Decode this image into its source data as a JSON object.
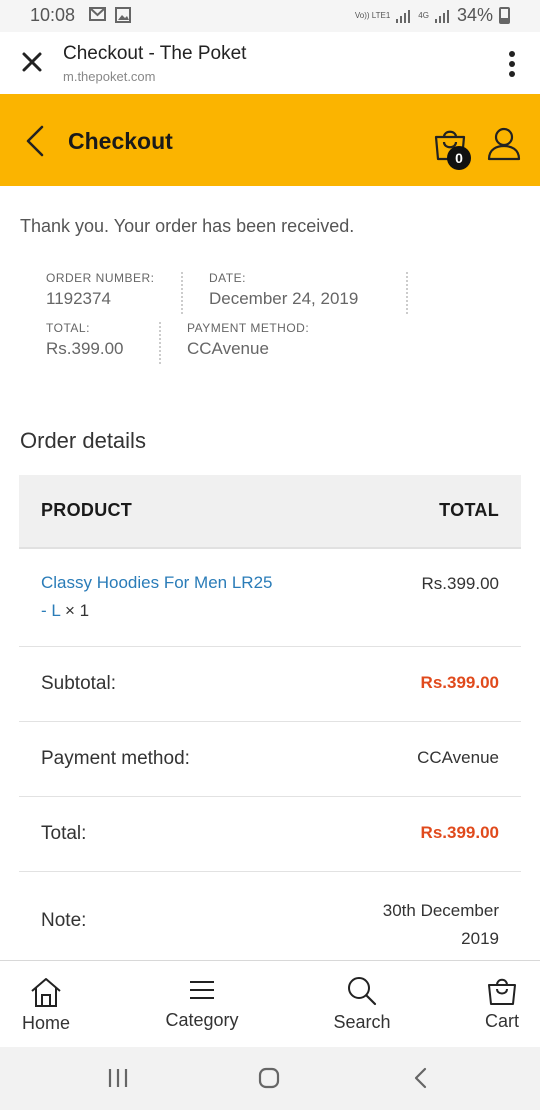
{
  "status_bar": {
    "time": "10:08",
    "network_label": "Vo)) LTE1",
    "network_label_2": "4G",
    "battery": "34%"
  },
  "browser_tab": {
    "title": "Checkout - The Poket",
    "url": "m.thepoket.com"
  },
  "header": {
    "title": "Checkout",
    "cart_count": "0",
    "accent_color": "#fbb400"
  },
  "order": {
    "thank_you": "Thank you. Your order has been received.",
    "order_number_label": "ORDER NUMBER:",
    "order_number": "1192374",
    "date_label": "DATE:",
    "date": "December 24, 2019",
    "total_label": "TOTAL:",
    "total": "Rs.399.00",
    "payment_method_label": "PAYMENT METHOD:",
    "payment_method": "CCAvenue"
  },
  "order_details": {
    "title": "Order details",
    "col_product": "PRODUCT",
    "col_total": "TOTAL",
    "product_name_line1": "Classy Hoodies For Men LR25",
    "product_name_line2": "- L",
    "product_qty": " × 1",
    "product_total": "Rs.399.00",
    "subtotal_label": "Subtotal:",
    "subtotal_value": "Rs.399.00",
    "payment_label": "Payment method:",
    "payment_value": "CCAvenue",
    "total_label": "Total:",
    "total_value": "Rs.399.00",
    "note_label": "Note:",
    "note_value_line1": "30th December",
    "note_value_line2": "2019",
    "highlight_color": "#e04a1c",
    "link_color": "#2a7cb8"
  },
  "bottom_nav": {
    "items": [
      {
        "label": "Home",
        "icon": "home-icon"
      },
      {
        "label": "Category",
        "icon": "menu-icon"
      },
      {
        "label": "Search",
        "icon": "search-icon"
      },
      {
        "label": "Cart",
        "icon": "shopping-bag-icon"
      }
    ]
  }
}
